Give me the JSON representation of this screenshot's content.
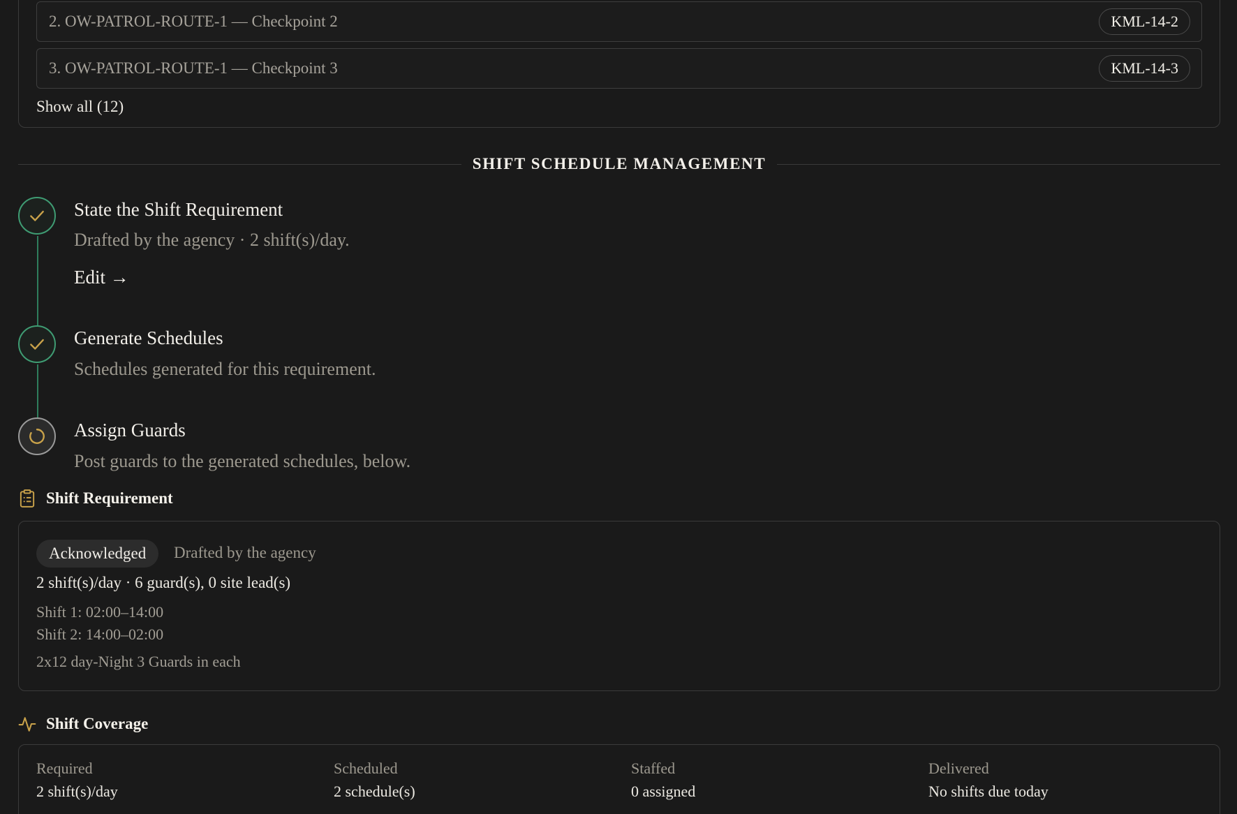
{
  "checkpoints": {
    "rows": [
      {
        "label": "2. OW-PATROL-ROUTE-1 — Checkpoint 2",
        "code": "KML-14-2"
      },
      {
        "label": "3. OW-PATROL-ROUTE-1 — Checkpoint 3",
        "code": "KML-14-3"
      }
    ],
    "show_all": "Show all (12)"
  },
  "section_title": "SHIFT SCHEDULE MANAGEMENT",
  "steps": [
    {
      "title": "State the Shift Requirement",
      "desc": "Drafted by the agency · 2 shift(s)/day.",
      "link": "Edit →",
      "status": "done"
    },
    {
      "title": "Generate Schedules",
      "desc": "Schedules generated for this requirement.",
      "status": "done"
    },
    {
      "title": "Assign Guards",
      "desc": "Post guards to the generated schedules, below.",
      "status": "in-progress"
    }
  ],
  "requirement": {
    "heading": "Shift Requirement",
    "status_badge": "Acknowledged",
    "note": "Drafted by the agency",
    "summary": "2 shift(s)/day · 6 guard(s), 0 site lead(s)",
    "shifts": [
      "Shift 1: 02:00–14:00",
      "Shift 2: 14:00–02:00"
    ],
    "comment": "2x12 day-Night 3 Guards in each"
  },
  "coverage": {
    "heading": "Shift Coverage",
    "stats": [
      {
        "label": "Required",
        "value": "2 shift(s)/day"
      },
      {
        "label": "Scheduled",
        "value": "2 schedule(s)"
      },
      {
        "label": "Staffed",
        "value": "0 assigned"
      },
      {
        "label": "Delivered",
        "value": "No shifts due today"
      }
    ]
  },
  "colors": {
    "background": "#1a1a1a",
    "done_green": "#3f9c73",
    "accent_gold": "#c9a24a",
    "muted_text": "#9d998f"
  },
  "icons": {
    "step_done": "checkmark-icon",
    "step_active": "spinner-icon",
    "requirement": "clipboard-icon",
    "coverage": "activity-pulse-icon"
  }
}
